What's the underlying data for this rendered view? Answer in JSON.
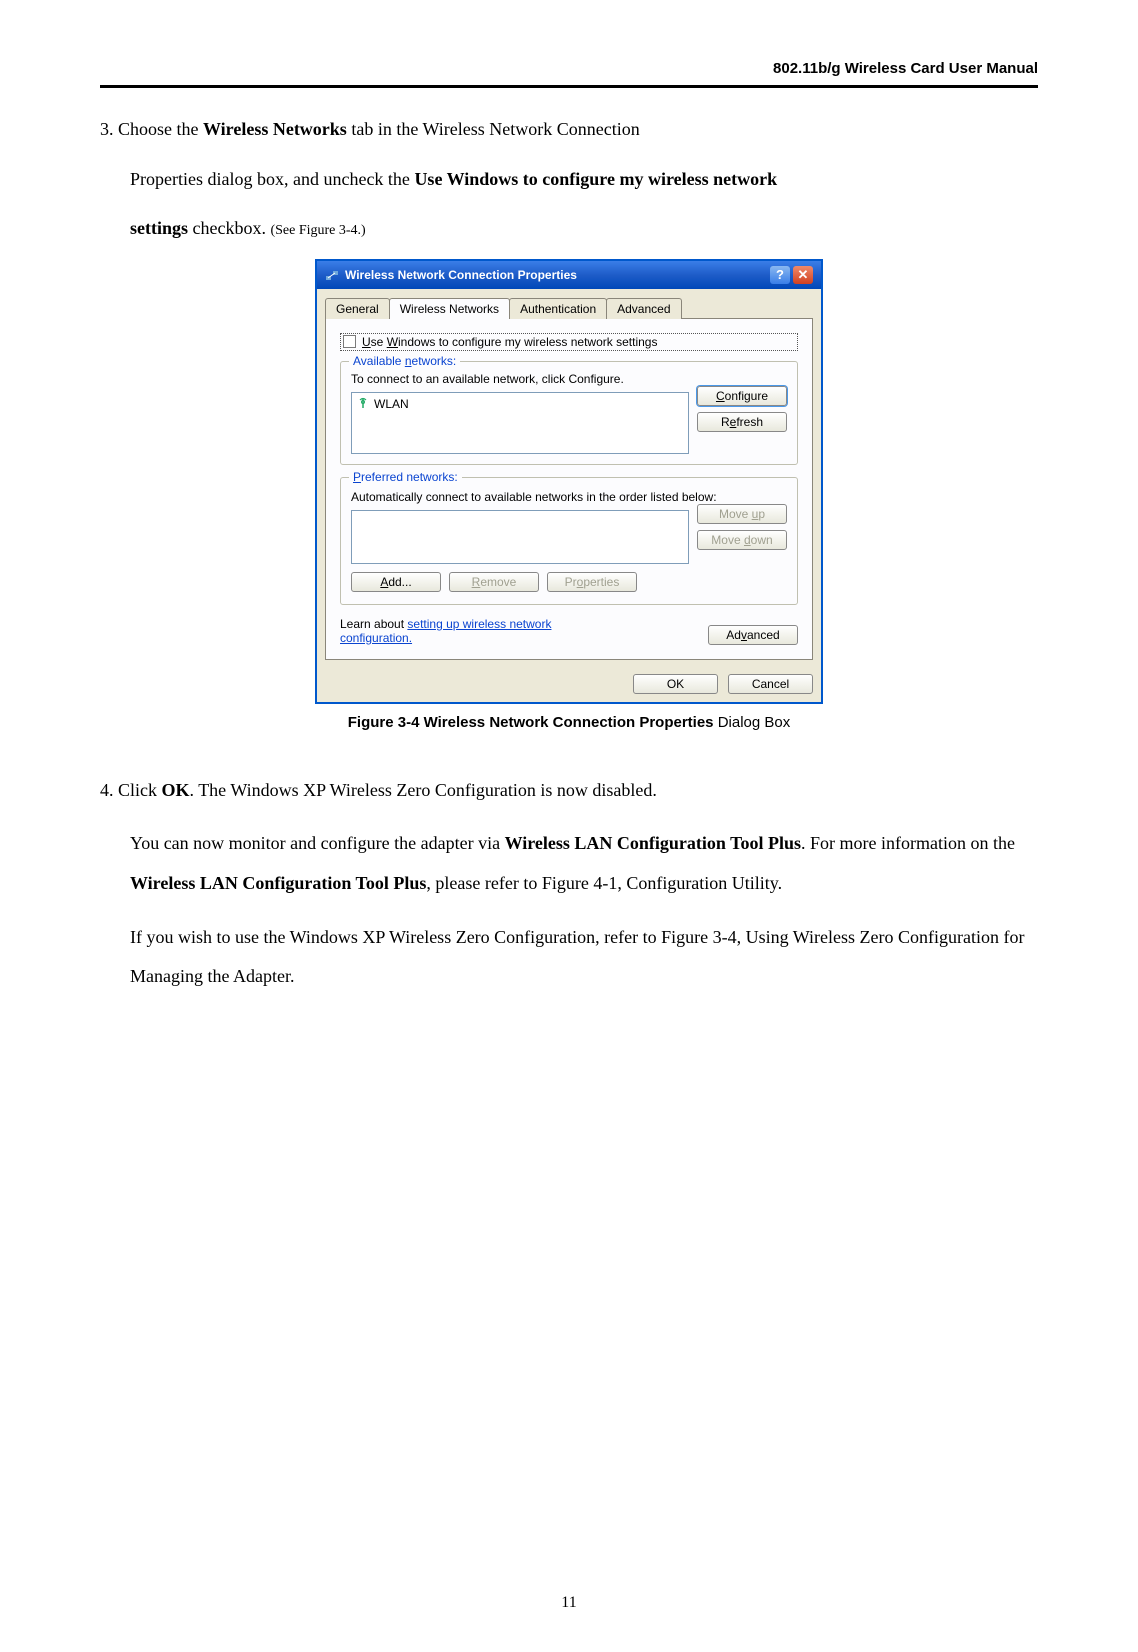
{
  "header": {
    "title": "802.11b/g Wireless Card User Manual"
  },
  "step3": {
    "prefix": "3. Choose the ",
    "bold1": "Wireless Networks",
    "mid1": " tab in the Wireless Network Connection",
    "line2a": "Properties dialog box, and uncheck the ",
    "bold2": "Use Windows to configure my wireless network",
    "line3a": "settings",
    "line3b": " checkbox. ",
    "see": "(See Figure 3-4.)"
  },
  "dialog": {
    "title": "Wireless Network Connection Properties",
    "tabs": {
      "general": "General",
      "wireless": "Wireless Networks",
      "auth": "Authentication",
      "advanced": "Advanced"
    },
    "checkbox_label": "Use Windows to configure my wireless network settings",
    "available": {
      "legend": "Available networks:",
      "instruction": "To connect to an available network, click Configure.",
      "item": "WLAN",
      "btn_configure": "Configure",
      "btn_refresh": "Refresh"
    },
    "preferred": {
      "legend": "Preferred networks:",
      "instruction": "Automatically connect to available networks in the order listed below:",
      "btn_moveup": "Move up",
      "btn_movedown": "Move down",
      "btn_add": "Add...",
      "btn_remove": "Remove",
      "btn_properties": "Properties"
    },
    "learn": {
      "text1": "Learn about ",
      "link": "setting up wireless network",
      "text2": "configuration."
    },
    "btn_advanced": "Advanced",
    "btn_ok": "OK",
    "btn_cancel": "Cancel"
  },
  "caption": {
    "bold": "Figure 3-4 Wireless Network Connection Properties ",
    "rest": "Dialog Box"
  },
  "step4": {
    "line1a": "4. Click ",
    "bold1": "OK",
    "line1b": ". The Windows XP Wireless Zero Configuration is now disabled.",
    "p2a": "You can now monitor and configure the adapter via ",
    "bold2": "Wireless LAN Configuration Tool Plus",
    "p2b": ". For more information on the ",
    "bold3": "Wireless LAN Configuration Tool Plus",
    "p2c": ", please refer to Figure 4-1, Configuration Utility.",
    "p3": "If you wish to use the Windows XP Wireless Zero Configuration, refer to Figure 3-4, Using Wireless Zero Configuration for Managing the Adapter."
  },
  "footer": {
    "page": "11"
  }
}
